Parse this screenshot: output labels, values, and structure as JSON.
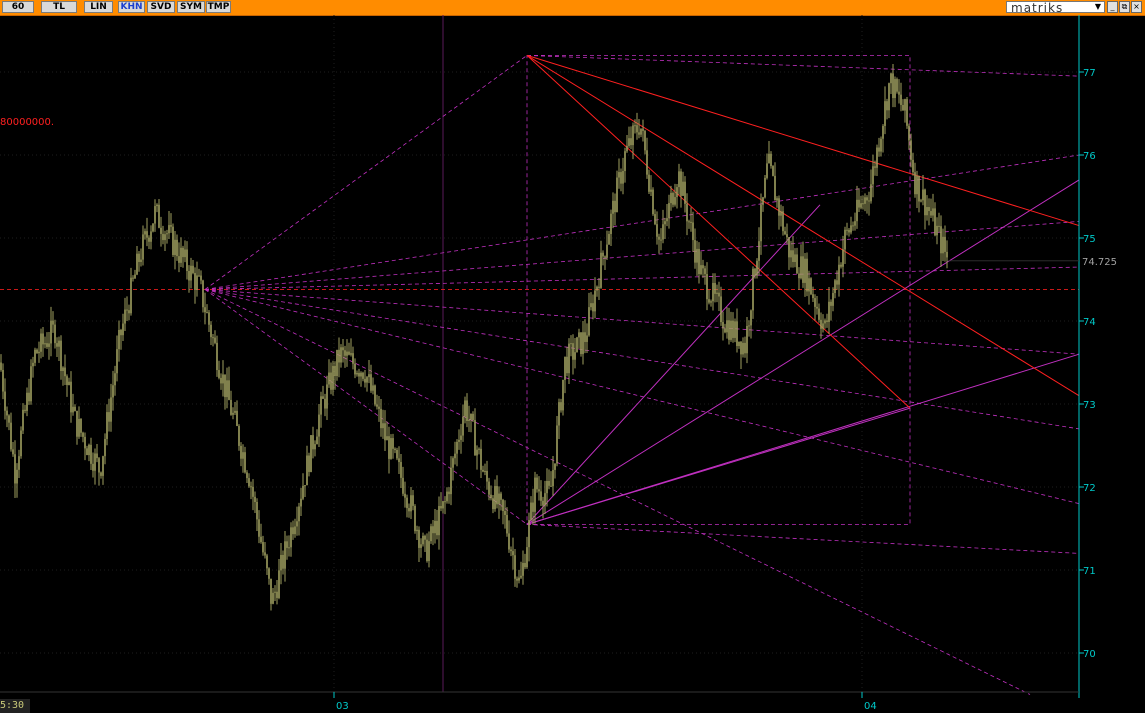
{
  "toolbar": {
    "buttons": [
      {
        "label": "60"
      },
      {
        "label": "TL"
      },
      {
        "label": "LIN"
      },
      {
        "label": "KHN",
        "active": true
      },
      {
        "label": "SVD"
      },
      {
        "label": "SYM"
      },
      {
        "label": "TMP"
      }
    ],
    "brand": "matriks",
    "brand_caret": "▼",
    "window_buttons": [
      "_",
      "⧉",
      "×"
    ]
  },
  "colors": {
    "background": "#000000",
    "toolbar": "#ff8c00",
    "candles": "#a0a060",
    "axis": "#00c8c8",
    "fan_lines": "#c030c0",
    "red_lines": "#ff2020",
    "label_red": "#ff2020"
  },
  "annotation_left": "80000000.",
  "time_label": "5:30",
  "chart_data": {
    "type": "candlestick",
    "ylim": [
      69.55,
      77.75
    ],
    "yticks": [
      70,
      71,
      72,
      73,
      74,
      75,
      76,
      77
    ],
    "last_price": "74.725",
    "x_labels": [
      "03",
      "04"
    ],
    "grid": true,
    "price_path": [
      [
        0,
        73.5
      ],
      [
        15,
        72.2
      ],
      [
        35,
        73.6
      ],
      [
        55,
        73.9
      ],
      [
        75,
        72.8
      ],
      [
        100,
        72.2
      ],
      [
        120,
        73.8
      ],
      [
        140,
        74.8
      ],
      [
        155,
        75.3
      ],
      [
        175,
        74.9
      ],
      [
        200,
        74.4
      ],
      [
        225,
        73.2
      ],
      [
        250,
        72.1
      ],
      [
        272,
        70.6
      ],
      [
        300,
        71.9
      ],
      [
        320,
        72.9
      ],
      [
        340,
        73.6
      ],
      [
        365,
        73.4
      ],
      [
        385,
        72.6
      ],
      [
        405,
        72.0
      ],
      [
        425,
        71.2
      ],
      [
        445,
        71.8
      ],
      [
        465,
        73.0
      ],
      [
        485,
        72.1
      ],
      [
        505,
        71.6
      ],
      [
        520,
        70.8
      ],
      [
        535,
        72.0
      ],
      [
        550,
        71.9
      ],
      [
        565,
        73.5
      ],
      [
        585,
        73.8
      ],
      [
        605,
        74.9
      ],
      [
        625,
        76.0
      ],
      [
        640,
        76.4
      ],
      [
        660,
        74.9
      ],
      [
        678,
        75.8
      ],
      [
        700,
        74.6
      ],
      [
        725,
        74.0
      ],
      [
        745,
        73.7
      ],
      [
        768,
        75.9
      ],
      [
        790,
        74.8
      ],
      [
        805,
        74.6
      ],
      [
        825,
        73.9
      ],
      [
        845,
        75.0
      ],
      [
        870,
        75.6
      ],
      [
        890,
        76.9
      ],
      [
        905,
        76.5
      ],
      [
        915,
        75.7
      ],
      [
        930,
        75.3
      ],
      [
        948,
        74.725
      ]
    ],
    "fan_origin_1": {
      "x": 205,
      "y": 74.38
    },
    "fan_box": {
      "x_start": 527,
      "x_end": 910,
      "y_high": 77.2,
      "y_low": 71.55
    },
    "dates_px": {
      "03": 334,
      "04": 862
    }
  }
}
